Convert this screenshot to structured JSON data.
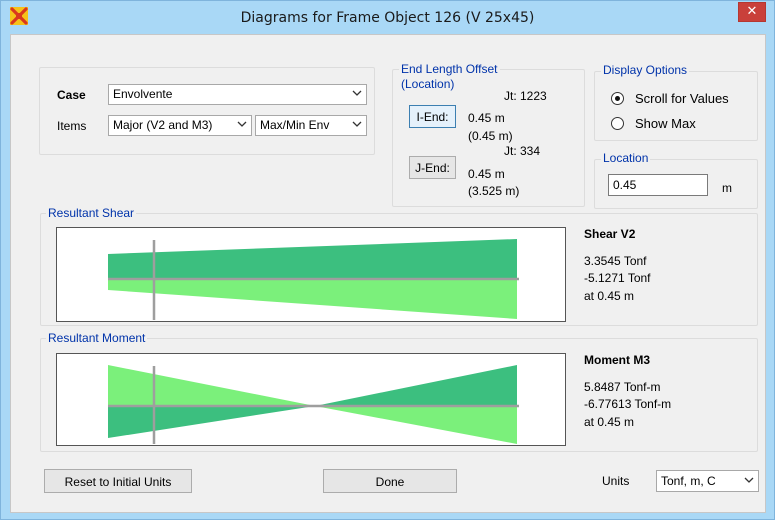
{
  "window": {
    "title": "Diagrams for Frame Object 126  (V 25x45)",
    "close_glyph": "✕"
  },
  "case": {
    "label": "Case",
    "value": "Envolvente"
  },
  "items": {
    "label": "Items",
    "component_value": "Major (V2 and M3)",
    "mode_value": "Max/Min Env"
  },
  "end_offset": {
    "title_line1": "End Length Offset",
    "title_line2": "(Location)",
    "i_end": {
      "button_label": "I-End:",
      "joint": "Jt:  1223",
      "length": "0.45 m",
      "location": "(0.45 m)"
    },
    "j_end": {
      "button_label": "J-End:",
      "joint": "Jt:  334",
      "length": "0.45 m",
      "location": "(3.525 m)"
    }
  },
  "display_options": {
    "title": "Display Options",
    "options": [
      {
        "label": "Scroll for Values",
        "checked": true
      },
      {
        "label": "Show Max",
        "checked": false
      }
    ]
  },
  "location": {
    "title": "Location",
    "value": "0.45",
    "unit": "m"
  },
  "shear": {
    "group_title": "Resultant Shear",
    "heading": "Shear V2",
    "max": "3.3545 Tonf",
    "min": "-5.1271 Tonf",
    "at": "at 0.45 m"
  },
  "moment": {
    "group_title": "Resultant Moment",
    "heading": "Moment M3",
    "max": "5.8487 Tonf-m",
    "min": "-6.77613 Tonf-m",
    "at": "at 0.45 m"
  },
  "footer": {
    "reset_label": "Reset to Initial Units",
    "done_label": "Done",
    "units_label": "Units",
    "units_value": "Tonf, m, C"
  },
  "colors": {
    "title_bar": "#a9d8f6",
    "close_button": "#c9403a",
    "group_title": "#0033aa",
    "diagram_dark_green": "#3cbf7f",
    "diagram_light_green": "#7bf07b",
    "axis_gray": "#9e9e9e"
  },
  "icons": {
    "app": "sap2000-app-icon",
    "close": "close-icon",
    "dropdown": "chevron-down-icon"
  }
}
